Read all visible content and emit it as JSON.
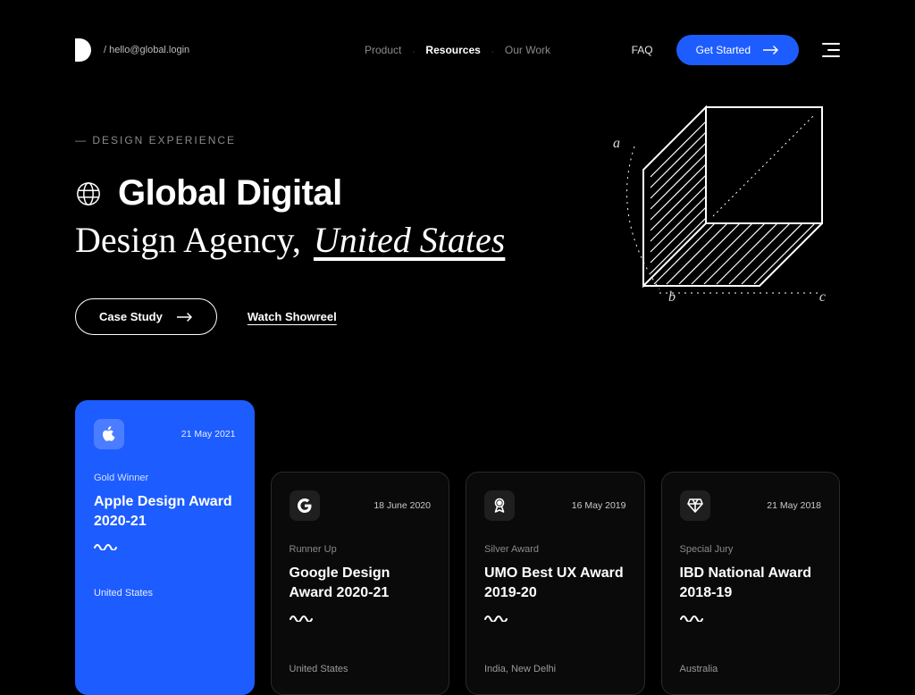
{
  "nav": {
    "contact": "/ hello@global.login",
    "links": [
      "Product",
      "Resources",
      "Our Work"
    ],
    "active_index": 1,
    "faq": "FAQ",
    "cta": "Get Started"
  },
  "hero": {
    "eyebrow": "— DESIGN EXPERIENCE",
    "title_bold": "Global Digital",
    "title_serif_a": "Design Agency,",
    "title_serif_b": "United States",
    "btn_case_study": "Case Study",
    "btn_showreel": "Watch Showreel",
    "cube_labels": {
      "a": "a",
      "b": "b",
      "c": "c"
    }
  },
  "awards": [
    {
      "icon": "apple",
      "date": "21 May 2021",
      "tag": "Gold Winner",
      "title": "Apple Design Award 2020-21",
      "location": "United States",
      "featured": true
    },
    {
      "icon": "google",
      "date": "18 June 2020",
      "tag": "Runner Up",
      "title": "Google Design Award 2020-21",
      "location": "United States",
      "featured": false
    },
    {
      "icon": "medal",
      "date": "16 May 2019",
      "tag": "Silver Award",
      "title": "UMO Best UX Award 2019-20",
      "location": "India, New Delhi",
      "featured": false
    },
    {
      "icon": "diamond",
      "date": "21 May 2018",
      "tag": "Special Jury",
      "title": "IBD National Award 2018-19",
      "location": "Australia",
      "featured": false
    }
  ],
  "colors": {
    "accent": "#1d5cff"
  }
}
